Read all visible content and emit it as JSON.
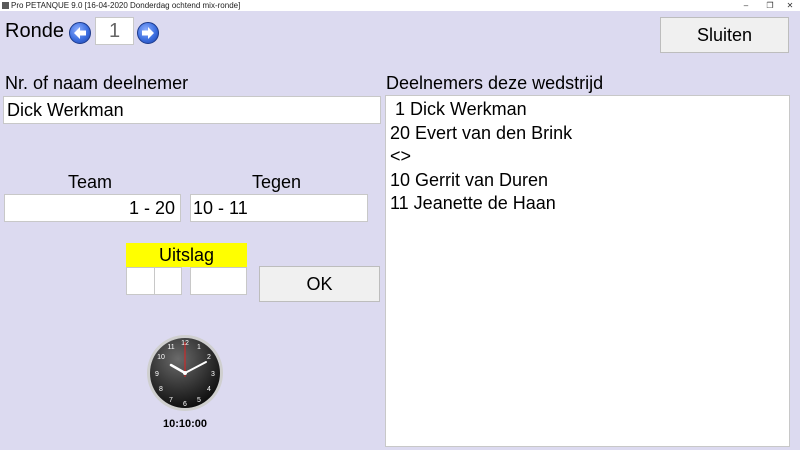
{
  "window": {
    "title": "Pro PETANQUE 9.0 [16-04-2020 Donderdag ochtend mix-ronde]",
    "minimize_glyph": "–",
    "restore_glyph": "❐",
    "close_glyph": "✕"
  },
  "ronde": {
    "label": "Ronde",
    "value": "1"
  },
  "close_button": {
    "label": "Sluiten"
  },
  "participant": {
    "label": "Nr. of naam deelnemer",
    "value": "Dick Werkman"
  },
  "team": {
    "label": "Team",
    "value": "1 - 20"
  },
  "tegen": {
    "label": "Tegen",
    "value": "10 - 11"
  },
  "uitslag": {
    "label": "Uitslag",
    "team_score": "",
    "tegen_score": ""
  },
  "ok_button": {
    "label": "OK"
  },
  "clock": {
    "time": "10:10:00"
  },
  "participants_list": {
    "label": "Deelnemers deze wedstrijd",
    "items": [
      " 1 Dick Werkman",
      "20 Evert van den Brink",
      "<>",
      "10 Gerrit van Duren",
      "11 Jeanette de Haan"
    ]
  },
  "colors": {
    "background": "#dcdaf0",
    "uitslag_header": "#ffff00"
  },
  "icons": {
    "prev": "arrow-left-icon",
    "next": "arrow-right-icon",
    "clock": "analog-clock-icon"
  }
}
